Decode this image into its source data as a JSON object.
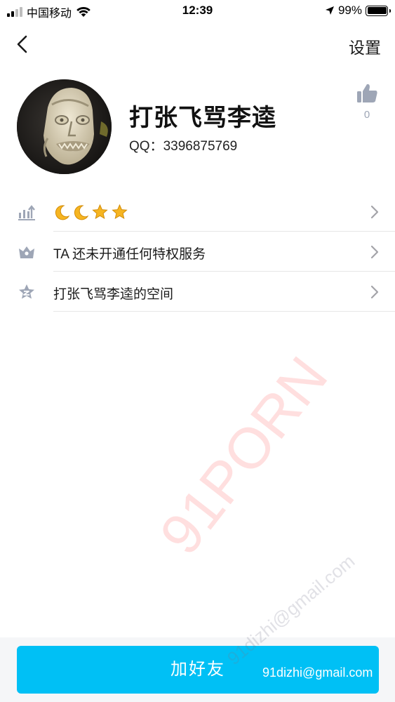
{
  "status_bar": {
    "carrier": "中国移动",
    "time": "12:39",
    "battery": "99%"
  },
  "nav": {
    "settings": "设置"
  },
  "profile": {
    "name": "打张飞骂李逵",
    "qq_label": "QQ：",
    "qq_number": "3396875769",
    "like_count": "0"
  },
  "list": {
    "level_icons": [
      "moon",
      "moon",
      "star",
      "star"
    ],
    "privilege_text": "TA 还未开通任何特权服务",
    "space_text": "打张飞骂李逵的空间"
  },
  "add_friend_button": "加好友",
  "watermark": {
    "brand": "91PORN",
    "email": "91dizhi@gmail.com"
  },
  "colors": {
    "accent": "#00c0f5",
    "icon_gray": "#9ea6b6",
    "star": "#f6b521",
    "moon": "#f6b521"
  }
}
